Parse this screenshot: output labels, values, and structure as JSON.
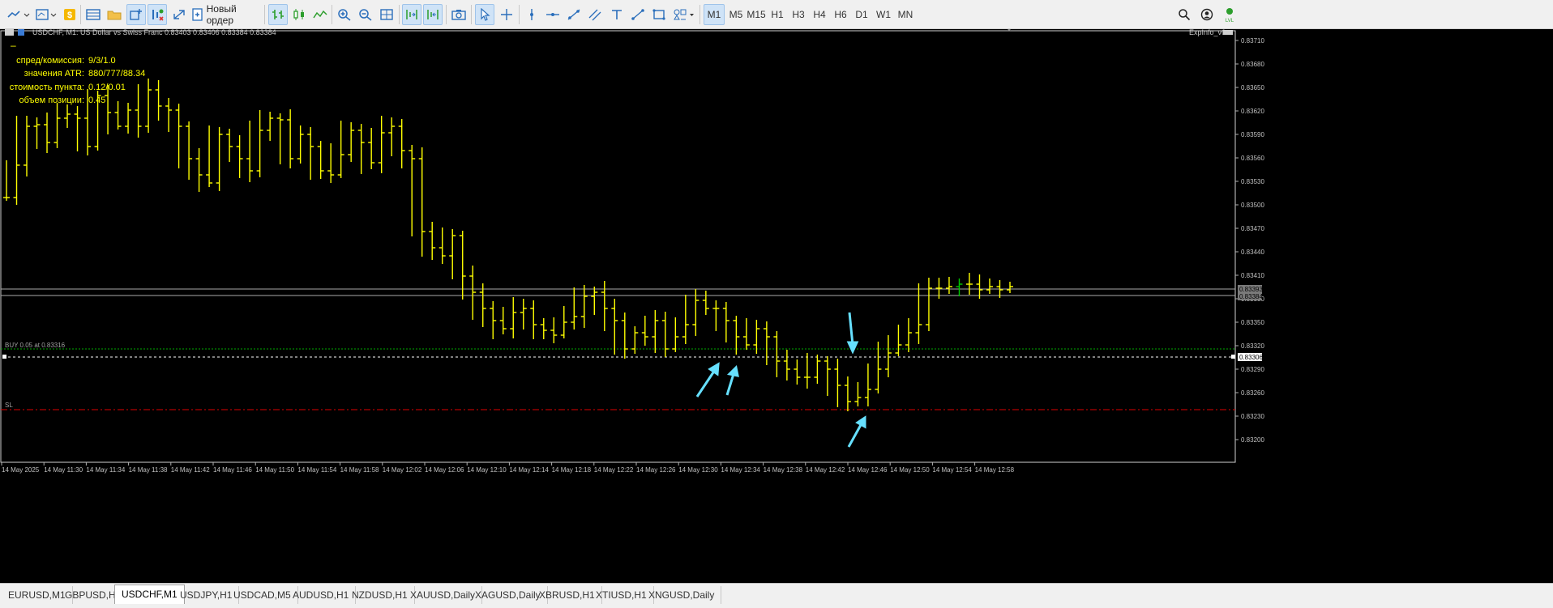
{
  "toolbar": {
    "new_order_label": "Новый ордер",
    "timeframes": [
      "M1",
      "M5",
      "M15",
      "H1",
      "H3",
      "H4",
      "H6",
      "D1",
      "W1",
      "MN"
    ],
    "active_timeframe": "M1"
  },
  "chart": {
    "title": "USDCHF, M1:  US Dollar vs Swiss Franc  0.83403 0.83406 0.83384 0.83384",
    "indicator_name": "ExpInfo_v6",
    "info_dash": "–",
    "info_panel": [
      {
        "label": "спред/комиссия:",
        "value": "9/3/1.0"
      },
      {
        "label": "значения ATR:",
        "value": "880/777/88.34"
      },
      {
        "label": "стоимость пункта:",
        "value": "0.12/0.01"
      },
      {
        "label": "объем позиции:",
        "value": "0.45"
      }
    ],
    "price_axis": [
      "0.83710",
      "0.83680",
      "0.83650",
      "0.83620",
      "0.83590",
      "0.83560",
      "0.83530",
      "0.83500",
      "0.83470",
      "0.83440",
      "0.83410",
      "0.83380",
      "0.83350",
      "0.83320",
      "0.83290",
      "0.83260",
      "0.83230",
      "0.83200"
    ],
    "time_axis": [
      "14 May 2025",
      "14 May 11:30",
      "14 May 11:34",
      "14 May 11:38",
      "14 May 11:42",
      "14 May 11:46",
      "14 May 11:50",
      "14 May 11:54",
      "14 May 11:58",
      "14 May 12:02",
      "14 May 12:06",
      "14 May 12:10",
      "14 May 12:14",
      "14 May 12:18",
      "14 May 12:22",
      "14 May 12:26",
      "14 May 12:30",
      "14 May 12:34",
      "14 May 12:38",
      "14 May 12:42",
      "14 May 12:46",
      "14 May 12:50",
      "14 May 12:54",
      "14 May 12:58"
    ],
    "ask_label": "0.83393",
    "bid_label": "0.83384",
    "order_label": "0.83306",
    "buy_line_text": "BUY 0.05 at 0.83316",
    "sl_line_text": "SL",
    "colors": {
      "bars": "#ffff00",
      "buy_line": "#00aa00",
      "sl_line": "#dd0000",
      "arrows": "#66e0ff",
      "grid_text": "#c0c0c0"
    }
  },
  "tabs": [
    {
      "label": "EURUSD,M1",
      "active": false
    },
    {
      "label": "GBPUSD,H1",
      "active": false
    },
    {
      "label": "USDCHF,M1",
      "active": true
    },
    {
      "label": "USDJPY,H1",
      "active": false
    },
    {
      "label": "USDCAD,M5",
      "active": false
    },
    {
      "label": "AUDUSD,H1",
      "active": false
    },
    {
      "label": "NZDUSD,H1",
      "active": false
    },
    {
      "label": "XAUUSD,Daily",
      "active": false
    },
    {
      "label": "XAGUSD,Daily",
      "active": false
    },
    {
      "label": "XBRUSD,H1",
      "active": false
    },
    {
      "label": "XTIUSD,H1",
      "active": false
    },
    {
      "label": "XNGUSD,Daily",
      "active": false
    }
  ]
}
